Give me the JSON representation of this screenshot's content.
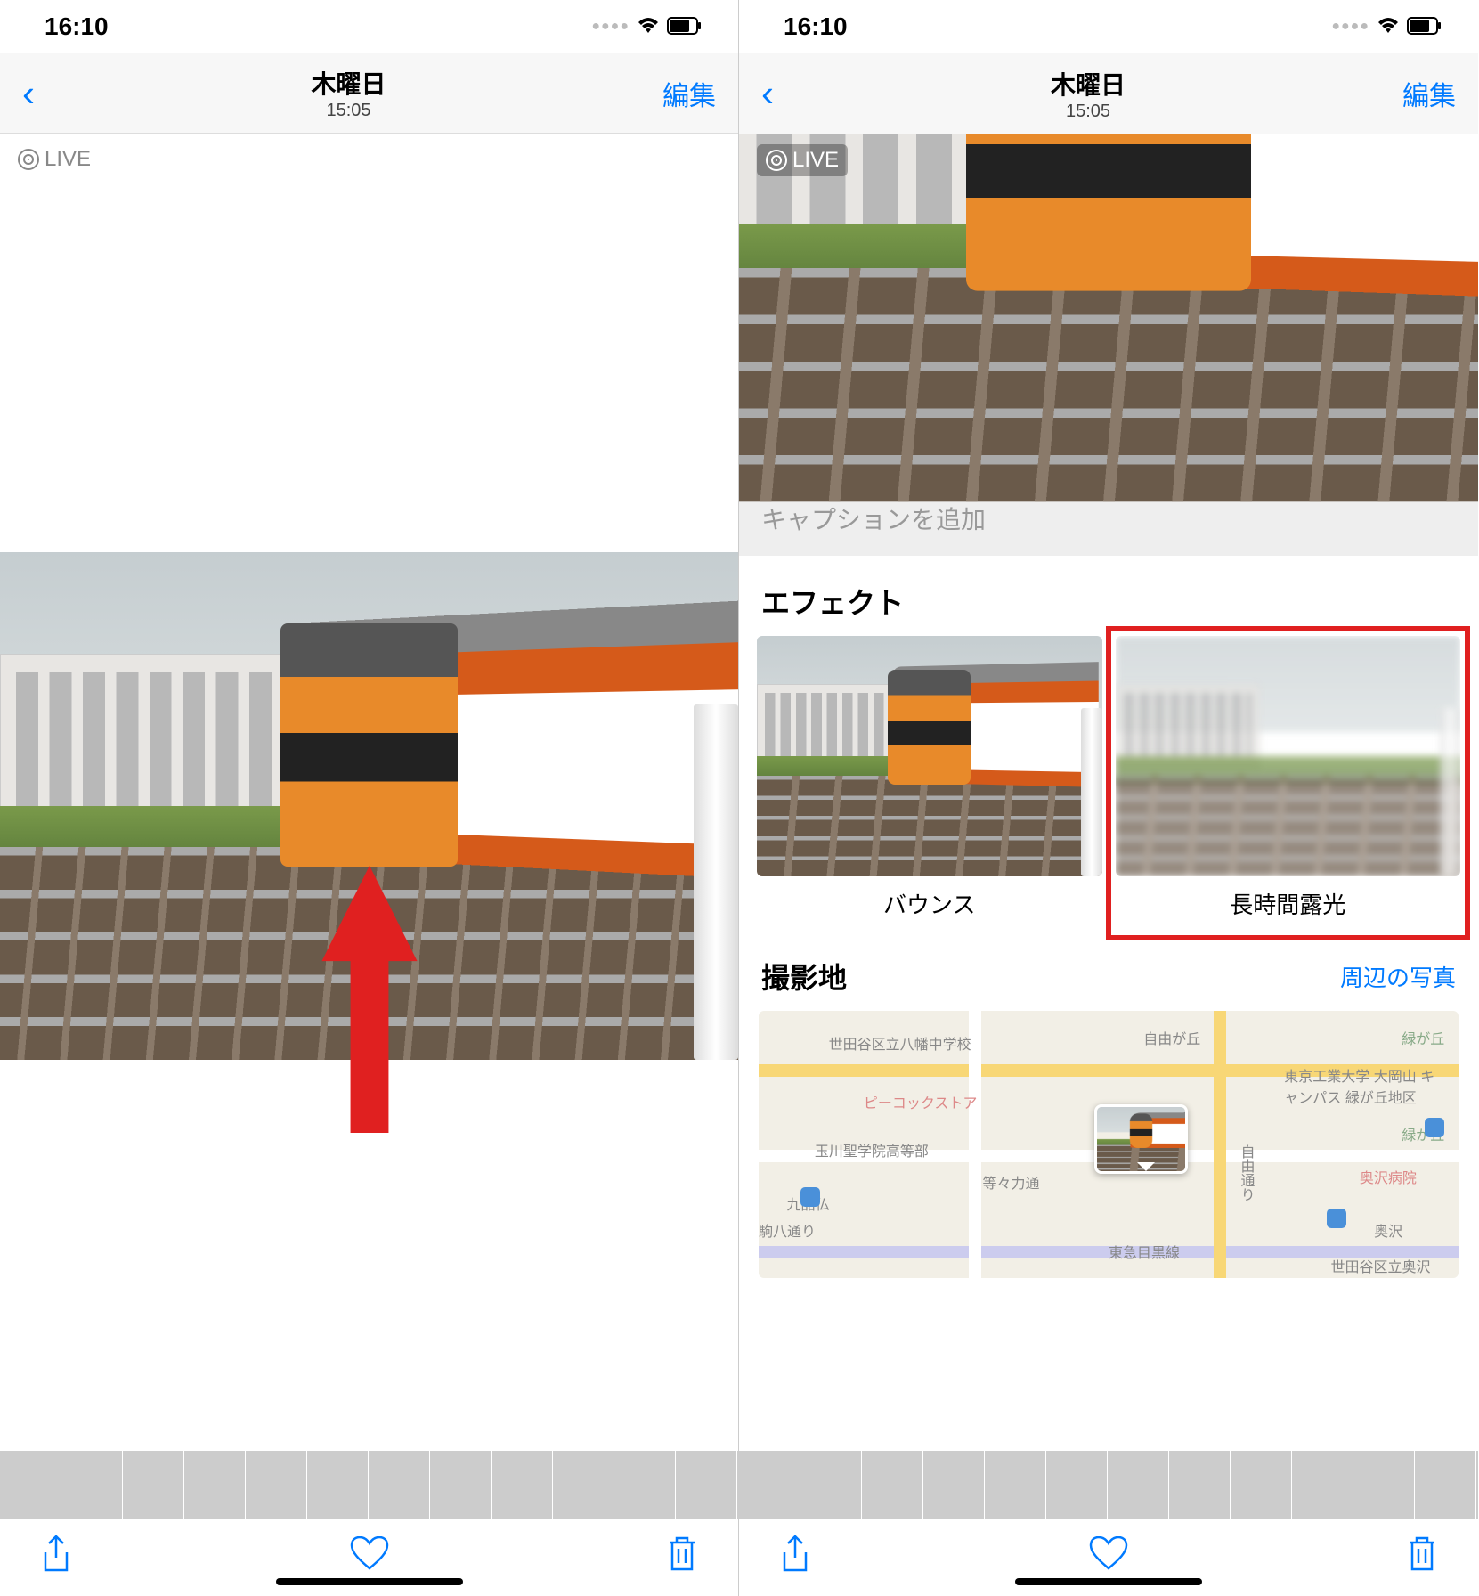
{
  "status": {
    "time": "16:10"
  },
  "nav": {
    "day": "木曜日",
    "time": "15:05",
    "edit": "編集"
  },
  "live_label": "LIVE",
  "caption_placeholder": "キャプションを追加",
  "sections": {
    "effects_title": "エフェクト",
    "location_title": "撮影地",
    "location_link": "周辺の写真"
  },
  "effects": [
    {
      "label": "バウンス"
    },
    {
      "label": "長時間露光"
    }
  ],
  "map_pois": {
    "school1": "世田谷区立八幡中学校",
    "peacock": "ピーコックストア",
    "school2": "玉川聖学院高等部",
    "kuhon": "九品仏",
    "toko": "等々力通",
    "komazawa": "駒八通り",
    "jiyuu": "自由が丘",
    "midori": "緑が丘",
    "univ": "東京工業大学 大岡山\nキャンパス 緑が丘地区",
    "hospital": "奥沢病院",
    "okusawa": "奥沢",
    "jiyuudori": "自由通り",
    "meguro": "東急目黒線",
    "setagaya": "世田谷区立奥沢"
  }
}
